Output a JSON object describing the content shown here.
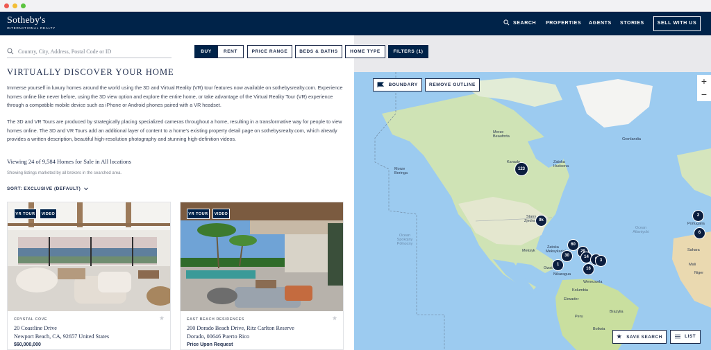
{
  "brand": {
    "name": "Sotheby's",
    "sub": "INTERNATIONAL REALTY"
  },
  "nav": {
    "search": "SEARCH",
    "properties": "PROPERTIES",
    "agents": "AGENTS",
    "stories": "STORIES",
    "sell": "SELL WITH US"
  },
  "search": {
    "placeholder": "Country, City, Address, Postal Code or ID"
  },
  "filters": {
    "buy": "BUY",
    "rent": "RENT",
    "price": "PRICE RANGE",
    "beds": "BEDS & BATHS",
    "type": "HOME TYPE",
    "filters": "FILTERS (1)"
  },
  "content": {
    "heading": "VIRTUALLY DISCOVER YOUR HOME",
    "para1": "Immerse yourself in luxury homes around the world using the 3D and Virtual Reality (VR) tour features now available on sothebysrealty.com. Experience homes online like never before, using the 3D view option and explore the entire home, or take advantage of the Virtual Reality Tour (VR) experience through a compatible mobile device such as iPhone or Android phones paired with a VR headset.",
    "para2": "The 3D and VR Tours are produced by strategically placing specialized cameras throughout a home, resulting in a transformative way for people to view homes online. The 3D and VR Tours add an additional layer of content to a home's existing property detail page on sothebysrealty.com, which already provides a written description, beautiful high-resolution photography and stunning high-definition videos.",
    "viewing": "Viewing 24 of 9,584 Homes for Sale in All locations",
    "showing": "Showing listings marketed by all brokers in the searched area.",
    "sort": "SORT: EXCLUSIVE (DEFAULT)"
  },
  "listings": [
    {
      "vr": "VR TOUR",
      "video": "VIDEO",
      "tag": "CRYSTAL COVE",
      "line1": "20 Coastline Drive",
      "line2": "Newport Beach, CA, 92657 United States",
      "price": "$60,000,000"
    },
    {
      "vr": "VR TOUR",
      "video": "VIDEO",
      "tag": "EAST BEACH RESIDENCES",
      "line1": "200 Dorado Beach Drive, Ritz Carlton Reserve",
      "line2": "Dorado, 00646 Puerto Rico",
      "price": "Price Upon Request"
    }
  ],
  "map": {
    "boundary": "BOUNDARY",
    "remove_outline": "REMOVE OUTLINE",
    "zoom_in": "+",
    "zoom_out": "−",
    "save_search": "SAVE SEARCH",
    "list": "LIST",
    "clusters": [
      "123",
      "9k",
      "60",
      "30",
      "29",
      "14",
      "6",
      "3",
      "16",
      "1",
      "2",
      "6"
    ],
    "labels": {
      "greenland": "Grenlandia",
      "canada": "Kanada",
      "hudson1": "Zatoka",
      "hudson2": "Hudsona",
      "beaufort1": "Morze",
      "beaufort2": "Beauforta",
      "bering1": "Morze",
      "bering2": "Beringa",
      "usa1": "Stany",
      "usa2": "Zjednoczone",
      "mexico": "Meksyk",
      "gulf1": "Zatoka",
      "gulf2": "Meksykańska",
      "guatemala": "Gwatemala",
      "nicaragua": "Nikaragua",
      "venezuela": "Wenezuela",
      "colombia": "Kolumbia",
      "ecuador": "Ekwador",
      "peru": "Peru",
      "brazil": "Brazylia",
      "bolivia": "Boliwia",
      "pacific1": "Ocean",
      "pacific2": "Spokojny",
      "pacific3": "Północny",
      "atlantic1": "Ocean",
      "atlantic2": "Atlantycki",
      "portugal": "Portugalia",
      "sahara": "Sahara",
      "mali": "Mali",
      "niger": "Niger"
    }
  }
}
